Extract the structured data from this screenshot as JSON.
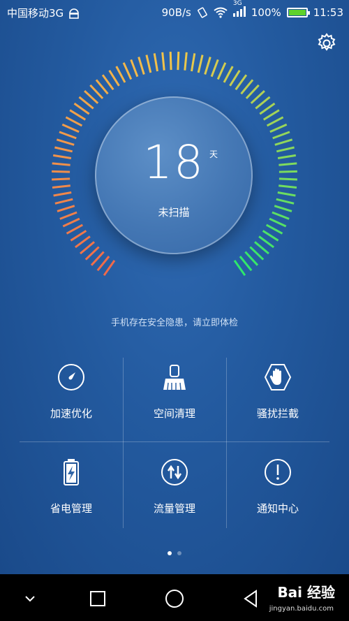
{
  "status_bar": {
    "carrier": "中国移动3G",
    "speed": "90B/s",
    "network": "3G",
    "battery_percent": "100%",
    "battery_level": 1.0,
    "time": "11:53"
  },
  "gauge": {
    "days": "18",
    "unit": "天",
    "status": "未扫描",
    "warning": "手机存在安全隐患，请立即体检",
    "colors": {
      "start": "#f06a4a",
      "mid": "#f2c64a",
      "end": "#2ee86b"
    }
  },
  "tools": [
    {
      "label": "加速优化",
      "icon": "speedometer-icon"
    },
    {
      "label": "空间清理",
      "icon": "broom-icon"
    },
    {
      "label": "骚扰拦截",
      "icon": "hand-block-icon"
    },
    {
      "label": "省电管理",
      "icon": "battery-icon"
    },
    {
      "label": "流量管理",
      "icon": "data-traffic-icon"
    },
    {
      "label": "通知中心",
      "icon": "notification-icon"
    }
  ],
  "pager": {
    "current_page": 1,
    "total_pages": 2
  },
  "watermark": {
    "text": "Bai 经验",
    "sub": "jingyan.baidu.com"
  }
}
